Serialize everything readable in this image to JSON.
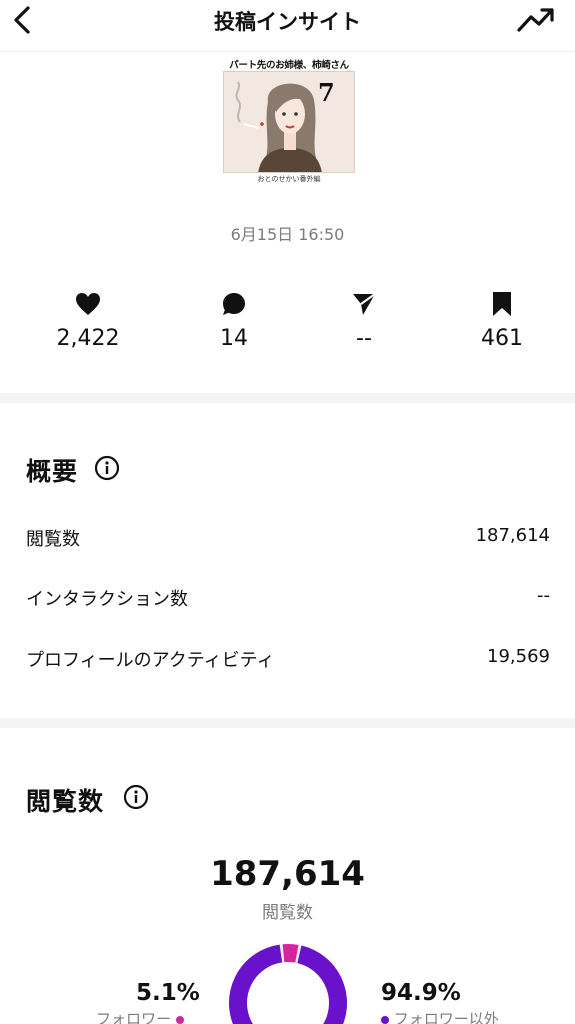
{
  "header": {
    "title": "投稿インサイト",
    "back_icon": "chevron-left-icon",
    "trend_icon": "trending-up-icon"
  },
  "post": {
    "caption_top": "パート先のお姉様、柿崎さん",
    "number": "7",
    "caption_bottom": "おとのせかい番外編",
    "date": "6月15日 16:50"
  },
  "stats": [
    {
      "icon": "heart-icon",
      "value": "2,422"
    },
    {
      "icon": "comment-icon",
      "value": "14"
    },
    {
      "icon": "share-icon",
      "value": "--"
    },
    {
      "icon": "bookmark-icon",
      "value": "461"
    }
  ],
  "overview": {
    "title": "概要",
    "rows": [
      {
        "label": "閲覧数",
        "value": "187,614"
      },
      {
        "label": "インタラクション数",
        "value": "--"
      },
      {
        "label": "プロフィールのアクティビティ",
        "value": "19,569"
      }
    ]
  },
  "views": {
    "title": "閲覧数",
    "total": "187,614",
    "total_label": "閲覧数",
    "followers": {
      "percent": "5.1%",
      "label": "フォロワー",
      "fraction": 0.051,
      "color": "#d6249f"
    },
    "non_followers": {
      "percent": "94.9%",
      "label": "フォロワー以外",
      "fraction": 0.949,
      "color": "#6a11cb"
    }
  }
}
